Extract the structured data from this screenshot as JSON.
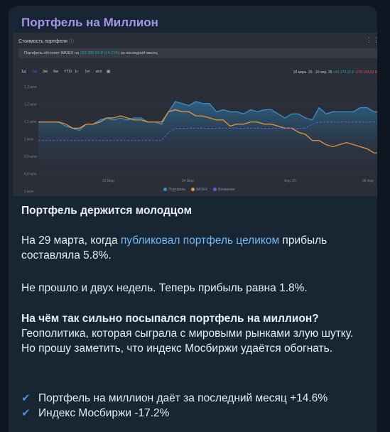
{
  "channel": {
    "title": "Портфель на Миллион"
  },
  "chart_widget": {
    "header": "Стоимость портфеля",
    "info_icon": "info-icon",
    "menu_icon": "more-dots-icon",
    "perf_prefix": "Портфель обгоняет IMOEX на",
    "perf_value": "153 390,84 ₽ (14,11%)",
    "perf_suffix": "за последний месяц",
    "ranges": [
      "1д",
      "1м",
      "3м",
      "6м",
      "YTD",
      "1г",
      "5л",
      "все"
    ],
    "calendar_icon": "calendar-icon",
    "date_range": "10 марь. 25 - 10 апр. 25",
    "change_up": "+43 172,11 ₽",
    "change_down": "-170 143,63 ₽"
  },
  "chart_data": {
    "type": "line",
    "y_tick_labels": [
      "1,3 млн",
      "1,2 млн",
      "1,1 млн",
      "1 млн",
      "0,9 млн",
      "0,8 млн",
      "1 млн"
    ],
    "x_tick_labels": [
      "16 Мар",
      "24 Мар",
      "Апр '25",
      "08 Апр"
    ],
    "legend": [
      "Портфель",
      "IMOEX",
      "Вложения"
    ],
    "ylim": [
      0.9,
      1.35
    ],
    "series": [
      {
        "name": "Портфель",
        "color": "#3b8fc4",
        "values": [
          1.15,
          1.15,
          1.15,
          1.15,
          1.13,
          1.12,
          1.11,
          1.14,
          1.14,
          1.16,
          1.17,
          1.16,
          1.17,
          1.16,
          1.17,
          1.17,
          1.15,
          1.15,
          1.14,
          1.2,
          1.25,
          1.24,
          1.23,
          1.25,
          1.24,
          1.24,
          1.2,
          1.21,
          1.2,
          1.2,
          1.19,
          1.21,
          1.2,
          1.21,
          1.21,
          1.19,
          1.17,
          1.19,
          1.19,
          1.17,
          1.16,
          1.22,
          1.19,
          1.2,
          1.2,
          1.2,
          1.2,
          1.22,
          1.22,
          1.2,
          1.2
        ]
      },
      {
        "name": "IMOEX",
        "color": "#e8973a",
        "values": [
          1.15,
          1.15,
          1.15,
          1.15,
          1.14,
          1.12,
          1.12,
          1.14,
          1.14,
          1.15,
          1.17,
          1.17,
          1.18,
          1.17,
          1.16,
          1.16,
          1.15,
          1.15,
          1.15,
          1.2,
          1.21,
          1.2,
          1.2,
          1.18,
          1.18,
          1.17,
          1.16,
          1.16,
          1.13,
          1.14,
          1.14,
          1.15,
          1.15,
          1.14,
          1.14,
          1.13,
          1.12,
          1.12,
          1.1,
          1.09,
          1.06,
          1.06,
          1.04,
          1.03,
          1.04,
          1.05,
          1.04,
          1.03,
          1.02,
          1.0,
          1.0
        ]
      },
      {
        "name": "Вложения",
        "color": "#5b5fd6",
        "values": [
          1.06,
          1.06,
          1.06,
          1.06,
          1.06,
          1.06,
          1.06,
          1.06,
          1.06,
          1.06,
          1.06,
          1.06,
          1.06,
          1.06,
          1.06,
          1.06,
          1.06,
          1.06,
          1.06,
          1.1,
          1.12,
          1.12,
          1.12,
          1.12,
          1.12,
          1.12,
          1.12,
          1.12,
          1.12,
          1.12,
          1.12,
          1.12,
          1.12,
          1.12,
          1.12,
          1.12,
          1.12,
          1.12,
          1.12,
          1.12,
          1.14,
          1.15,
          1.15,
          1.15,
          1.15,
          1.15,
          1.15,
          1.15,
          1.15,
          1.15,
          1.15
        ]
      }
    ],
    "grid": true
  },
  "post": {
    "heading": "Портфель держится молодцом",
    "p1_before": "На 29 марта, когда ",
    "p1_link": "публиковал портфель целиком",
    "p1_after": " прибыль составляла 5.8%.",
    "p2": "Не прошло и двух недель. Теперь прибыль равна 1.8%.",
    "p3_bold": "На чём так сильно посыпался портфель на миллион?",
    "p3_rest": "Геополитика, которая сыграла с мировыми рынками злую шутку. Но прошу заметить, что индекс Мосбиржи удаётся обогнать.",
    "checks": [
      "Портфель на миллион даёт за последний месяц +14.6%",
      "Индекс Мосбиржи -17.2%"
    ],
    "check_icon": "check-icon"
  }
}
